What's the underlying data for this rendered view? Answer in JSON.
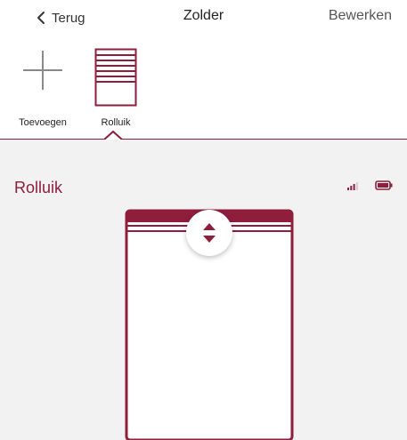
{
  "nav": {
    "back_label": "Terug",
    "title": "Zolder",
    "edit_label": "Bewerken"
  },
  "devices": [
    {
      "label": "Toevoegen",
      "icon": "plus-icon"
    },
    {
      "label": "Rolluik",
      "icon": "rolluik-icon",
      "selected": true
    }
  ],
  "main": {
    "device_title": "Rolluik"
  },
  "colors": {
    "accent": "#8f1d3c",
    "background": "#f2f2f2"
  }
}
